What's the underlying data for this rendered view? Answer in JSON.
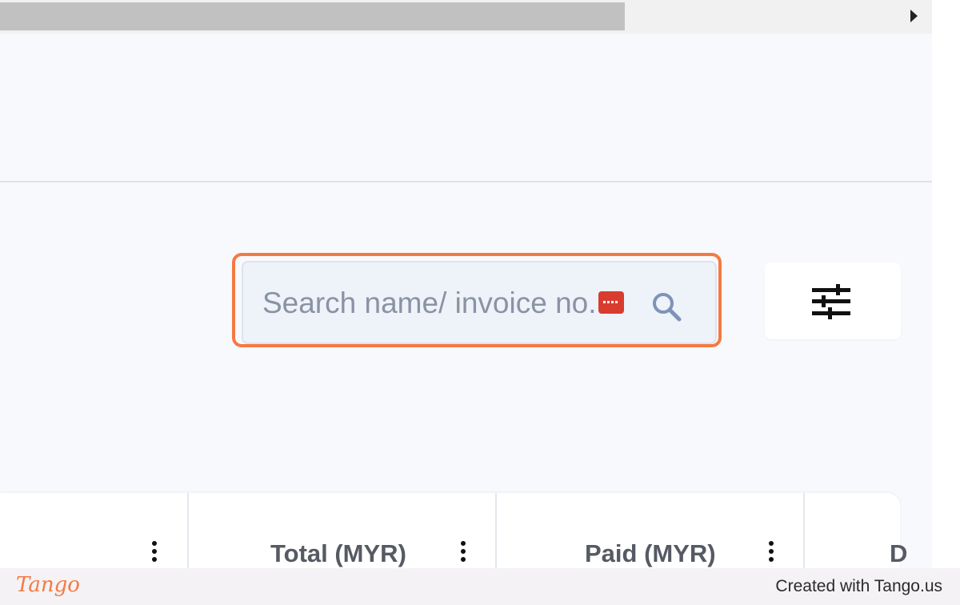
{
  "search": {
    "placeholder": "Search name/ invoice no."
  },
  "table": {
    "columns": [
      {
        "label": ""
      },
      {
        "label": "Total (MYR)"
      },
      {
        "label": "Paid (MYR)"
      },
      {
        "label": "D"
      }
    ]
  },
  "footer": {
    "logo_text": "Tango",
    "credit": "Created with Tango.us"
  },
  "colors": {
    "highlight": "#f47a43",
    "background": "#f8f9fc",
    "search_bg": "#eef2f9",
    "extension_badge": "#d93c2f"
  },
  "icons": {
    "scroll_right": "scroll-right-arrow-icon",
    "search": "search-icon",
    "filter": "filter-sliders-icon",
    "kebab": "kebab-menu-icon",
    "extension": "password-manager-icon"
  }
}
